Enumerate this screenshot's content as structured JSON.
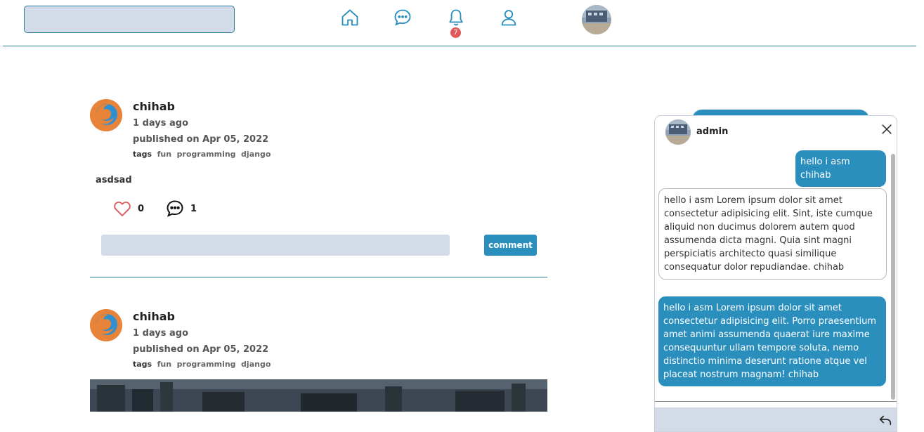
{
  "topbar": {
    "search_value": "",
    "notification_count": "7",
    "icons": [
      "home-icon",
      "chat-bubble-icon",
      "bell-icon",
      "user-icon"
    ]
  },
  "colors": {
    "accent": "#2a8fbd",
    "border": "#2a7f9e",
    "input_bg": "#d3dae8",
    "badge": "#e05a5a",
    "like": "#e05a5a"
  },
  "posts": [
    {
      "author": "chihab",
      "ago": "1 days ago",
      "published": "published on Apr 05, 2022",
      "tags_label": "tags",
      "tags": [
        "fun",
        "programming",
        "django"
      ],
      "body": "asdsad",
      "likes": "0",
      "comments": "1",
      "comment_value": "",
      "comment_button": "comment"
    },
    {
      "author": "chihab",
      "ago": "1 days ago",
      "published": "published on Apr 05, 2022",
      "tags_label": "tags",
      "tags": [
        "fun",
        "programming",
        "django"
      ]
    }
  ],
  "chat": {
    "name": "admin",
    "messages": [
      {
        "direction": "out",
        "text": "hello i asm chihab"
      },
      {
        "direction": "in",
        "text": "hello i asm Lorem ipsum dolor sit amet consectetur adipisicing elit. Sint, iste cumque aliquid non ducimus dolorem autem quod assumenda dicta magni. Quia sint magni perspiciatis architecto quasi similique consequatur dolor repudiandae. chihab"
      },
      {
        "direction": "out",
        "text": "hello i asm Lorem ipsum dolor sit amet consectetur adipisicing elit. Porro praesentium amet animi assumenda quaerat iure maxime consequuntur ullam tempore soluta, nemo distinctio minima deserunt ratione atque vel placeat nostrum magnam! chihab"
      }
    ],
    "input_value": ""
  }
}
